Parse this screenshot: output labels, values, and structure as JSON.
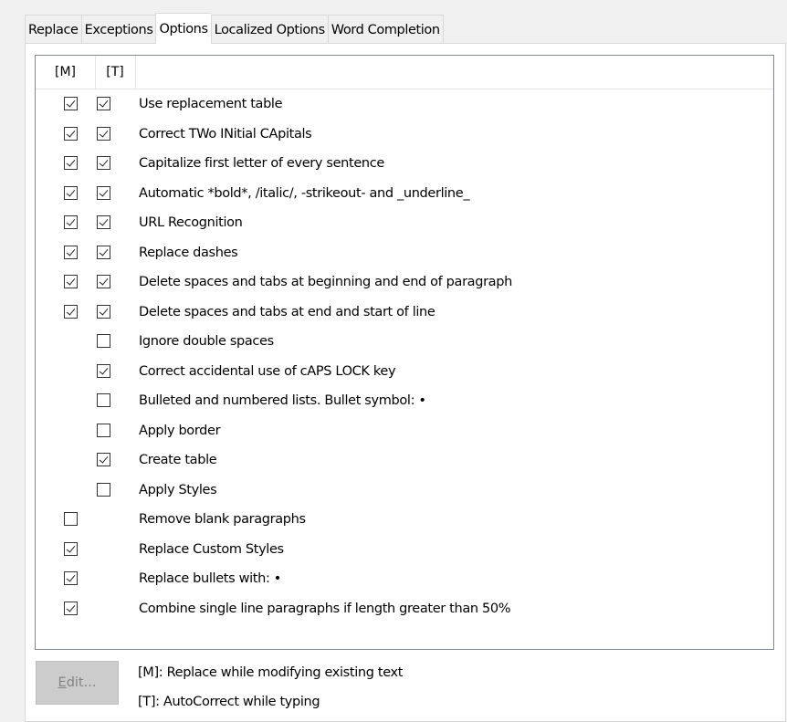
{
  "tabs": [
    "Replace",
    "Exceptions",
    "Options",
    "Localized Options",
    "Word Completion"
  ],
  "active_tab": "Options",
  "headers": {
    "m": "[M]",
    "t": "[T]"
  },
  "options": [
    {
      "label": "Use replacement table",
      "m": true,
      "t": true
    },
    {
      "label": "Correct TWo INitial CApitals",
      "m": true,
      "t": true
    },
    {
      "label": "Capitalize first letter of every sentence",
      "m": true,
      "t": true
    },
    {
      "label": "Automatic *bold*, /italic/, -strikeout- and _underline_",
      "m": true,
      "t": true
    },
    {
      "label": "URL Recognition",
      "m": true,
      "t": true
    },
    {
      "label": "Replace dashes",
      "m": true,
      "t": true
    },
    {
      "label": "Delete spaces and tabs at beginning and end of paragraph",
      "m": true,
      "t": true
    },
    {
      "label": "Delete spaces and tabs at end and start of line",
      "m": true,
      "t": true
    },
    {
      "label": "Ignore double spaces",
      "m": null,
      "t": false
    },
    {
      "label": "Correct accidental use of cAPS LOCK key",
      "m": null,
      "t": true
    },
    {
      "label": "Bulleted and numbered lists. Bullet symbol: •",
      "m": null,
      "t": false
    },
    {
      "label": "Apply border",
      "m": null,
      "t": false
    },
    {
      "label": "Create table",
      "m": null,
      "t": true
    },
    {
      "label": "Apply Styles",
      "m": null,
      "t": false
    },
    {
      "label": "Remove blank paragraphs",
      "m": false,
      "t": null
    },
    {
      "label": "Replace Custom Styles",
      "m": true,
      "t": null
    },
    {
      "label": "Replace bullets with: •",
      "m": true,
      "t": null
    },
    {
      "label": "Combine single line paragraphs if length greater than 50%",
      "m": true,
      "t": null
    }
  ],
  "edit_button": {
    "prefix": "E",
    "rest": "dit..."
  },
  "notes": {
    "m": "[M]: Replace while modifying existing text",
    "t": "[T]: AutoCorrect while typing"
  }
}
